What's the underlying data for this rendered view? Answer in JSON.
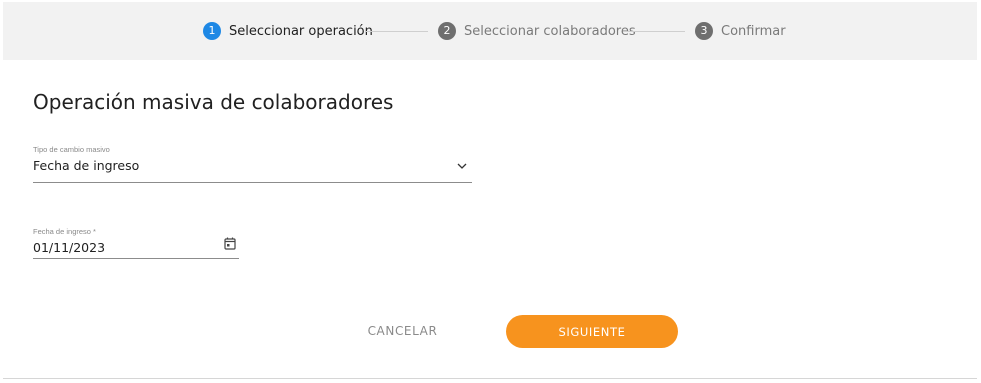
{
  "stepper": {
    "steps": [
      {
        "number": "1",
        "label": "Seleccionar operación",
        "state": "active"
      },
      {
        "number": "2",
        "label": "Seleccionar colaboradores",
        "state": "inactive"
      },
      {
        "number": "3",
        "label": "Confirmar",
        "state": "inactive"
      }
    ]
  },
  "page": {
    "title": "Operación masiva de colaboradores"
  },
  "form": {
    "change_type": {
      "label": "Tipo de cambio masivo",
      "value": "Fecha de ingreso",
      "icon": "chevron-down-icon"
    },
    "start_date": {
      "label": "Fecha de ingreso *",
      "value": "01/11/2023",
      "icon": "calendar-icon"
    }
  },
  "actions": {
    "cancel_label": "CANCELAR",
    "next_label": "SIGUIENTE"
  },
  "colors": {
    "active_step": "#1e88e5",
    "inactive_step": "#6f6f6f",
    "primary_button": "#f7931e"
  }
}
